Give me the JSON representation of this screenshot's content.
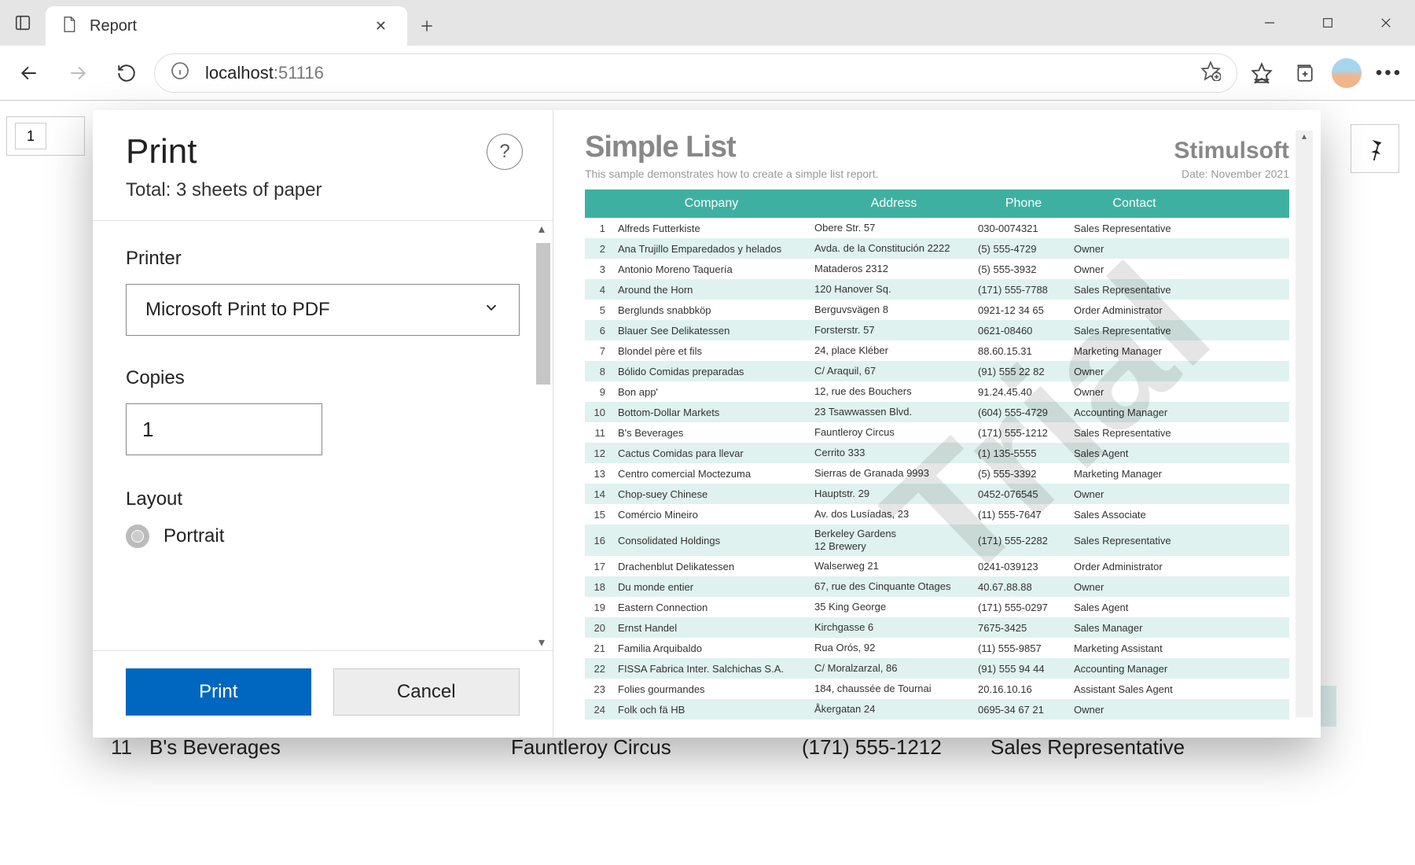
{
  "browser": {
    "tab_title": "Report",
    "url_host": "localhost",
    "url_path": ":51116",
    "page_input": "1"
  },
  "print_dialog": {
    "title": "Print",
    "total": "Total: 3 sheets of paper",
    "printer_label": "Printer",
    "printer_value": "Microsoft Print to PDF",
    "copies_label": "Copies",
    "copies_value": "1",
    "layout_label": "Layout",
    "layout_value": "Portrait",
    "print_btn": "Print",
    "cancel_btn": "Cancel",
    "help": "?"
  },
  "preview": {
    "title": "Simple List",
    "brand": "Stimulsoft",
    "subtitle": "This sample demonstrates how to create a simple list report.",
    "date": "Date: November 2021",
    "watermark": "Trial",
    "columns": [
      "Company",
      "Address",
      "Phone",
      "Contact"
    ],
    "rows": [
      {
        "n": "1",
        "company": "Alfreds Futterkiste",
        "address": "Obere Str. 57",
        "phone": "030-0074321",
        "contact": "Sales Representative"
      },
      {
        "n": "2",
        "company": "Ana Trujillo Emparedados y helados",
        "address": "Avda. de la Constitución 2222",
        "phone": "(5) 555-4729",
        "contact": "Owner"
      },
      {
        "n": "3",
        "company": "Antonio Moreno Taquería",
        "address": "Mataderos  2312",
        "phone": "(5) 555-3932",
        "contact": "Owner"
      },
      {
        "n": "4",
        "company": "Around the Horn",
        "address": "120 Hanover Sq.",
        "phone": "(171) 555-7788",
        "contact": "Sales Representative"
      },
      {
        "n": "5",
        "company": "Berglunds snabbköp",
        "address": "Berguvsvägen  8",
        "phone": "0921-12 34 65",
        "contact": "Order Administrator"
      },
      {
        "n": "6",
        "company": "Blauer See Delikatessen",
        "address": "Forsterstr. 57",
        "phone": "0621-08460",
        "contact": "Sales Representative"
      },
      {
        "n": "7",
        "company": "Blondel père et fils",
        "address": "24, place Kléber",
        "phone": "88.60.15.31",
        "contact": "Marketing Manager"
      },
      {
        "n": "8",
        "company": "Bólido Comidas preparadas",
        "address": "C/ Araquil, 67",
        "phone": "(91) 555 22 82",
        "contact": "Owner"
      },
      {
        "n": "9",
        "company": "Bon app'",
        "address": "12, rue des Bouchers",
        "phone": "91.24.45.40",
        "contact": "Owner"
      },
      {
        "n": "10",
        "company": "Bottom-Dollar Markets",
        "address": "23 Tsawwassen Blvd.",
        "phone": "(604) 555-4729",
        "contact": "Accounting Manager"
      },
      {
        "n": "11",
        "company": "B's Beverages",
        "address": "Fauntleroy Circus",
        "phone": "(171) 555-1212",
        "contact": "Sales Representative"
      },
      {
        "n": "12",
        "company": "Cactus Comidas para llevar",
        "address": "Cerrito 333",
        "phone": "(1) 135-5555",
        "contact": "Sales Agent"
      },
      {
        "n": "13",
        "company": "Centro comercial Moctezuma",
        "address": "Sierras de Granada 9993",
        "phone": "(5) 555-3392",
        "contact": "Marketing Manager"
      },
      {
        "n": "14",
        "company": "Chop-suey Chinese",
        "address": "Hauptstr. 29",
        "phone": "0452-076545",
        "contact": "Owner"
      },
      {
        "n": "15",
        "company": "Comércio Mineiro",
        "address": "Av. dos Lusíadas, 23",
        "phone": "(11) 555-7647",
        "contact": "Sales Associate"
      },
      {
        "n": "16",
        "company": "Consolidated Holdings",
        "address": "Berkeley Gardens\n12  Brewery",
        "phone": "(171) 555-2282",
        "contact": "Sales Representative"
      },
      {
        "n": "17",
        "company": "Drachenblut Delikatessen",
        "address": "Walserweg 21",
        "phone": "0241-039123",
        "contact": "Order Administrator"
      },
      {
        "n": "18",
        "company": "Du monde entier",
        "address": "67, rue des Cinquante Otages",
        "phone": "40.67.88.88",
        "contact": "Owner"
      },
      {
        "n": "19",
        "company": "Eastern Connection",
        "address": "35 King George",
        "phone": "(171) 555-0297",
        "contact": "Sales Agent"
      },
      {
        "n": "20",
        "company": "Ernst Handel",
        "address": "Kirchgasse 6",
        "phone": "7675-3425",
        "contact": "Sales Manager"
      },
      {
        "n": "21",
        "company": "Familia Arquibaldo",
        "address": "Rua Orós, 92",
        "phone": "(11) 555-9857",
        "contact": "Marketing Assistant"
      },
      {
        "n": "22",
        "company": "FISSA Fabrica Inter. Salchichas S.A.",
        "address": "C/ Moralzarzal, 86",
        "phone": "(91) 555 94 44",
        "contact": "Accounting Manager"
      },
      {
        "n": "23",
        "company": "Folies gourmandes",
        "address": "184, chaussée de Tournai",
        "phone": "20.16.10.16",
        "contact": "Assistant Sales Agent"
      },
      {
        "n": "24",
        "company": "Folk och fä HB",
        "address": "Åkergatan 24",
        "phone": "0695-34 67 21",
        "contact": "Owner"
      }
    ]
  },
  "bg_rows": [
    {
      "n": "9",
      "company": "Bon app'",
      "address": "12, rue des Bouchers",
      "phone": "91.24.45.40",
      "contact": "Owner",
      "alt": false
    },
    {
      "n": "10",
      "company": "Bottom-Dollar Markets",
      "address": "23 Tsawwassen Blvd.",
      "phone": "(604) 555-4729",
      "contact": "Accounting Manager",
      "alt": true
    },
    {
      "n": "11",
      "company": "B's Beverages",
      "address": "Fauntleroy Circus",
      "phone": "(171) 555-1212",
      "contact": "Sales Representative",
      "alt": false
    }
  ]
}
